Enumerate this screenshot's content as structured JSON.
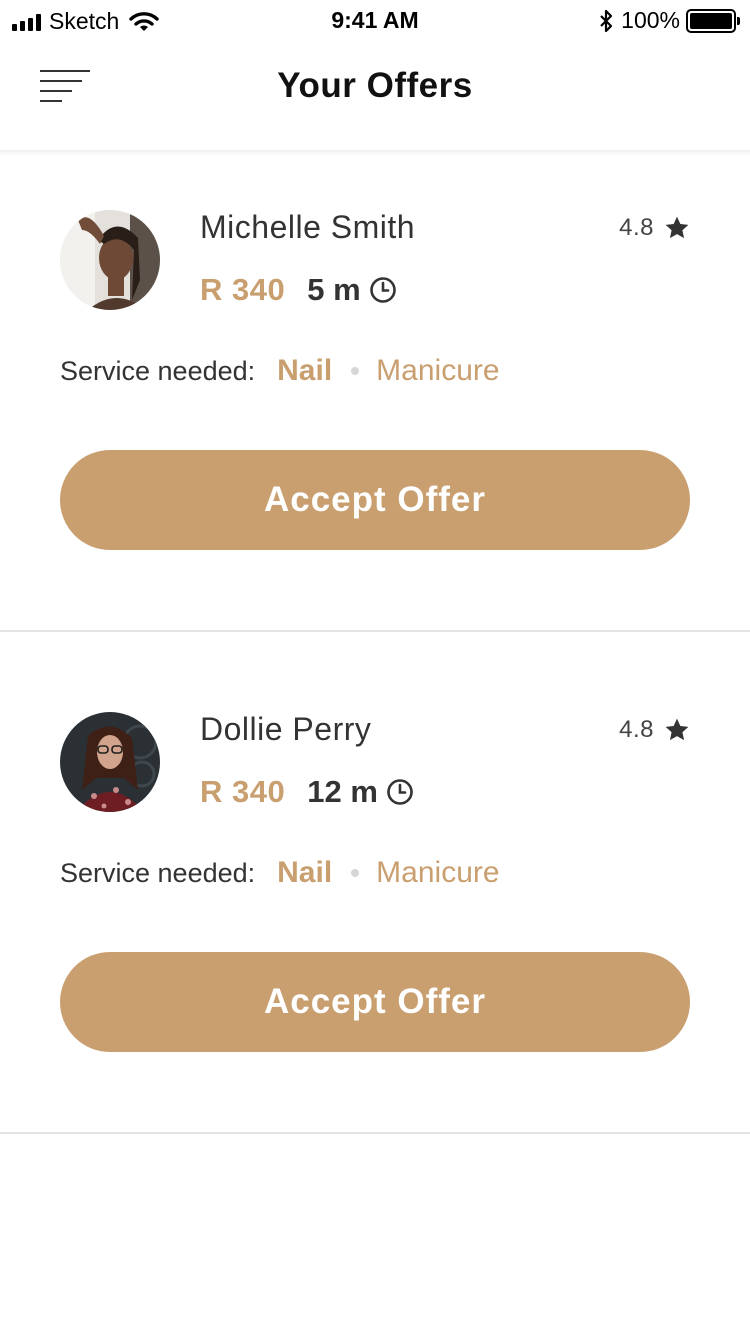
{
  "status_bar": {
    "carrier": "Sketch",
    "time": "9:41 AM",
    "battery": "100%"
  },
  "header": {
    "title": "Your Offers",
    "menu_icon": "menu-icon"
  },
  "theme": {
    "accent": "#c99f70",
    "text": "#333333",
    "divider": "#e3e3e3"
  },
  "offers": [
    {
      "name": "Michelle Smith",
      "rating": "4.8",
      "price": "R 340",
      "duration": "5 m",
      "service_label": "Service needed:",
      "service_primary": "Nail",
      "service_secondary": "Manicure",
      "action": "Accept Offer"
    },
    {
      "name": "Dollie Perry",
      "rating": "4.8",
      "price": "R 340",
      "duration": "12 m",
      "service_label": "Service needed:",
      "service_primary": "Nail",
      "service_secondary": "Manicure",
      "action": "Accept Offer"
    }
  ]
}
